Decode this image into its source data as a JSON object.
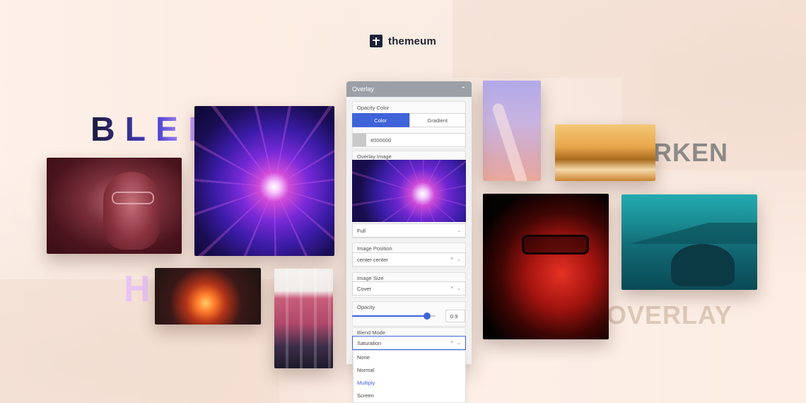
{
  "brand": {
    "name": "themeum"
  },
  "words": {
    "blend": "BLEND",
    "hue": "HUE",
    "darken": "DARKEN",
    "overlay": "OVERLAY"
  },
  "panel": {
    "title": "Overlay",
    "opacity_color": {
      "label": "Opacity Color",
      "tabs": [
        "Color",
        "Gradient"
      ],
      "active_tab": "Color",
      "hex": "#000000"
    },
    "overlay_image": {
      "label": "Overlay Image",
      "size_value": "Full"
    },
    "image_position": {
      "label": "Image Position",
      "value": "center center"
    },
    "image_size": {
      "label": "Image Size",
      "value": "Cover"
    },
    "opacity": {
      "label": "Opacity",
      "value": "0.9",
      "fraction": 0.9
    },
    "blend_mode": {
      "label": "Blend Mode",
      "value": "Saturation",
      "options": [
        "None",
        "Normal",
        "Multiply",
        "Screen"
      ],
      "highlighted": "Multiply"
    }
  },
  "colors": {
    "accent": "#3f63d8",
    "panel_header": "#9aa0a6",
    "background": "#fbeadf",
    "brand_dark": "#1e2235"
  },
  "icons": {
    "collapse": "chevron-up-icon",
    "clear": "close-icon",
    "expand": "chevron-down-icon"
  }
}
